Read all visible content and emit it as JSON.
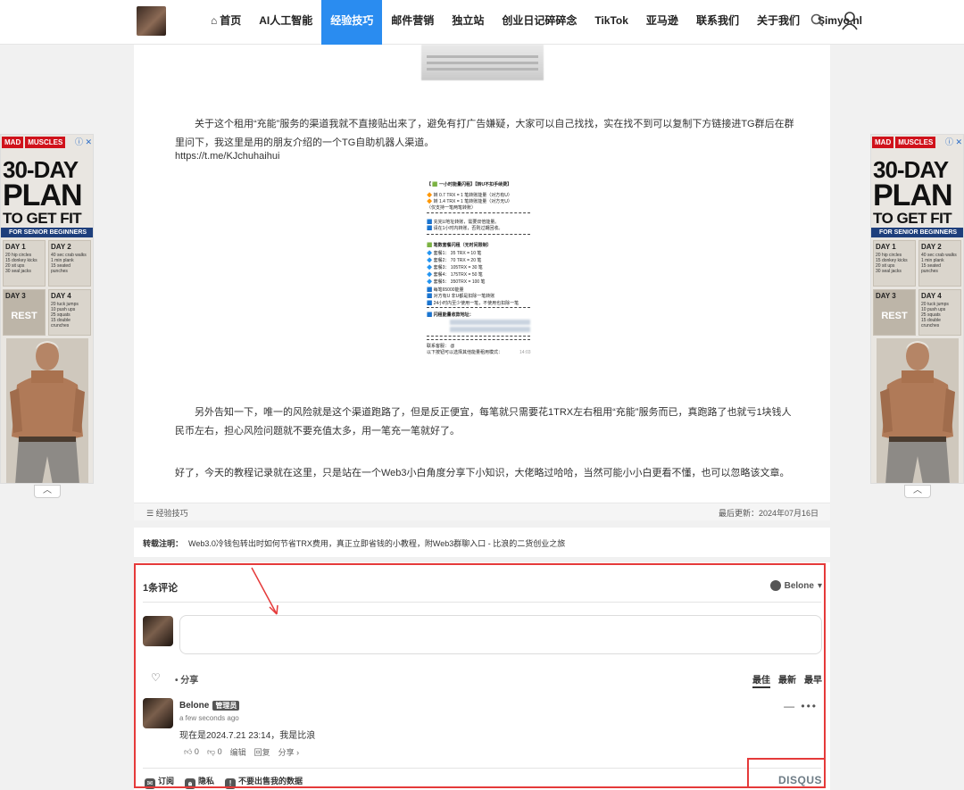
{
  "header": {
    "nav": [
      {
        "label": "首页",
        "active": false
      },
      {
        "label": "AI人工智能",
        "active": false
      },
      {
        "label": "经验技巧",
        "active": true
      },
      {
        "label": "邮件营销",
        "active": false
      },
      {
        "label": "独立站",
        "active": false
      },
      {
        "label": "创业日记碎碎念",
        "active": false
      },
      {
        "label": "TikTok",
        "active": false
      },
      {
        "label": "亚马逊",
        "active": false
      },
      {
        "label": "联系我们",
        "active": false
      },
      {
        "label": "关于我们",
        "active": false
      },
      {
        "label": "Simyo.nl",
        "active": false
      }
    ],
    "icons": {
      "home": "home-icon",
      "search": "search-icon",
      "user": "user-icon"
    }
  },
  "ad": {
    "brand_left": "MAD",
    "brand_right": "MUSCLES",
    "line1": "30-DAY",
    "line2": "PLAN",
    "line3": "TO GET FIT",
    "band": "FOR SENIOR BEGINNERS",
    "days": [
      {
        "day": "DAY 1",
        "text": "20 hip circles\n15 donkey kicks\n20 sit ups\n30 seal jacks"
      },
      {
        "day": "DAY 2",
        "text": "40 sec crab walks\n1 min plank\n15 seated punches"
      },
      {
        "day": "DAY 3",
        "text": "REST"
      },
      {
        "day": "DAY 4",
        "text": "20 tuck jumps\n10 push ups\n25 squats\n15 double crunches"
      }
    ],
    "close": "ⓘ ✕",
    "scroll_up": "︿"
  },
  "article": {
    "para1": "关于这个租用“充能”服务的渠道我就不直接贴出来了，避免有打广告嫌疑，大家可以自己找找，实在找不到可以复制下方链接进TG群后在群里问下，我这里是用的朋友介绍的一个TG自助机器人渠道。",
    "link": "https://t.me/KJchuhaihui",
    "para2": "另外告知一下，唯一的风险就是这个渠道跑路了，但是反正便宜，每笔就只需要花1TRX左右租用“充能”服务而已，真跑路了也就亏1块钱人民币左右，担心风险问题就不要充值太多，用一笔充一笔就好了。",
    "para3": "好了，今天的教程记录就在这里，只是站在一个Web3小白角度分享下小知识，大佬略过哈哈，当然可能小小白更看不懂，也可以忽略该文章。",
    "image_lines": [
      "【 🟩 一小时能量闪租】【转U不扣手续费】",
      "🔶 转 0.7 TRX = 1 笔转账能量（对方有U）",
      "🔶 转 1.4 TRX = 1 笔转账能量（对方无U）",
      "（仅支持一笔两笔转账）",
      "🟦 充完U地址转账，需要双倍能量。",
      "🟦 请在1小时内转账，否则过期回收。",
      "🟩 笔数套餐闪租（无时间限制）",
      "🔷 套餐1：  35 TRX = 10 笔",
      "🔷 套餐2：  70 TRX = 20 笔",
      "🔷 套餐3：  105TRX = 30 笔",
      "🔷 套餐4：  175TRX = 50 笔",
      "🔷 套餐5：  350TRX = 100 笔",
      "🟦 每笔65000能量",
      "🟦 对方有U 非U都是扣除一笔转账",
      "🟦 24小时内至少使用一笔，不使用也扣除一笔",
      "🟦 闪租能量收款地址：",
      "联系客服： @",
      "以下按钮可以选择其他能量租用模式："
    ],
    "image_time": "14:03"
  },
  "meta": {
    "category": "经验技巧",
    "updated": "最后更新：2024年07月16日"
  },
  "reprint": {
    "label": "转载注明：",
    "text": "Web3.0冷钱包转出时如何节省TRX费用，真正立即省钱的小教程，附Web3群聊入口 - 比浪的二货创业之旅"
  },
  "comments": {
    "count": "1条评论",
    "user": "Belone",
    "share": "• 分享",
    "sort": [
      {
        "label": "最佳",
        "active": true
      },
      {
        "label": "最新",
        "active": false
      },
      {
        "label": "最早",
        "active": false
      }
    ],
    "comment": {
      "author": "Belone",
      "badge": "管理员",
      "time": "a few seconds ago",
      "text": "现在是2024.7.21 23:14，我是比浪",
      "up": "0",
      "down": "0",
      "edit": "编辑",
      "reply": "回复",
      "share": "分享 ›"
    },
    "footer": {
      "subscribe": "订阅",
      "privacy": "隐私",
      "do_not_sell": "不要出售我的数据"
    },
    "brand": "DISQUS"
  },
  "colors": {
    "nav_active": "#2a8cf0",
    "annotation_red": "#e53a3a"
  }
}
